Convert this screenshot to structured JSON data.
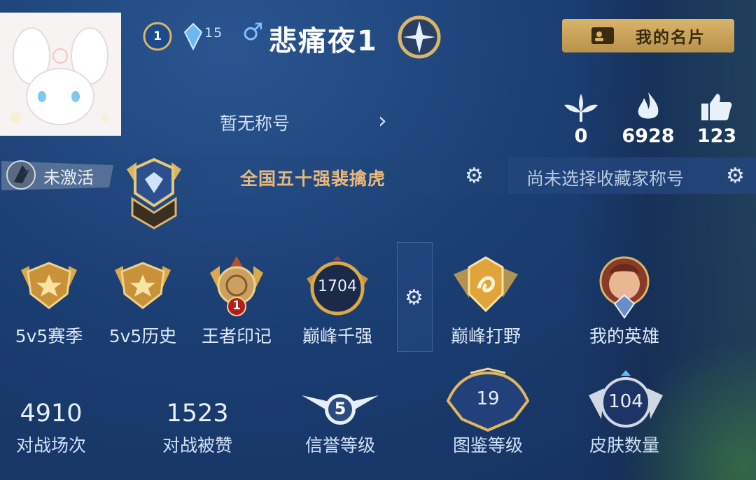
{
  "header": {
    "level": "1",
    "crystal_count": "15",
    "gender_symbol": "♂",
    "player_name": "悲痛夜1",
    "name_card_label": "我的名片",
    "title_text": "暂无称号",
    "chevron": "›"
  },
  "stats": [
    {
      "icon": "flower-icon",
      "value": "0"
    },
    {
      "icon": "flame-icon",
      "value": "6928"
    },
    {
      "icon": "thumbs-up-icon",
      "value": "123"
    }
  ],
  "titles_bar": {
    "inactive_label": "未激活",
    "power_title": "全国五十强裴擒虎",
    "collector_title": "尚未选择收藏家称号"
  },
  "badges": [
    {
      "label": "5v5赛季"
    },
    {
      "label": "5v5历史"
    },
    {
      "label": "王者印记",
      "count": "1"
    },
    {
      "label": "巅峰千强",
      "value": "1704"
    },
    {
      "label": "巅峰打野"
    },
    {
      "label": "我的英雄"
    }
  ],
  "bottom_stats": [
    {
      "value": "4910",
      "label": "对战场次"
    },
    {
      "value": "1523",
      "label": "对战被赞"
    },
    {
      "value": "5",
      "label": "信誉等级"
    },
    {
      "value": "19",
      "label": "图鉴等级"
    },
    {
      "value": "104",
      "label": "皮肤数量"
    }
  ],
  "colors": {
    "background": "#1b3e73",
    "gold": "#d9b56a",
    "title_orange": "#e8b77b"
  }
}
